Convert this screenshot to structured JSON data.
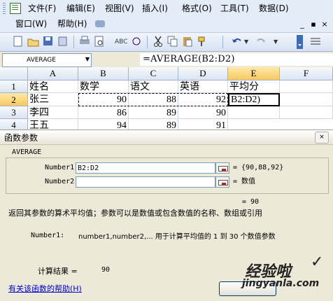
{
  "menubar": {
    "items": [
      "文件(F)",
      "编辑(E)",
      "视图(V)",
      "插入(I)",
      "格式(O)",
      "工具(T)",
      "数据(D)"
    ],
    "row2": [
      "窗口(W)",
      "帮助(H)"
    ],
    "window_controls": [
      "_",
      "▪",
      "×"
    ]
  },
  "formula_bar": {
    "name_box": "AVERAGE",
    "formula": "=AVERAGE(B2:D2)"
  },
  "sheet": {
    "columns": [
      "A",
      "B",
      "C",
      "D",
      "E",
      "F"
    ],
    "rows": [
      "1",
      "2",
      "3",
      "4"
    ],
    "cells": {
      "r1": [
        "姓名",
        "数学",
        "语文",
        "英语",
        "平均分"
      ],
      "r2": [
        "张三",
        "90",
        "88",
        "92",
        "B2:D2)"
      ],
      "r3": [
        "李四",
        "86",
        "89",
        "90"
      ],
      "r4": [
        "王五",
        "94",
        "89",
        "91"
      ]
    }
  },
  "dialog": {
    "title": "函数参数",
    "close": "×",
    "function_name": "AVERAGE",
    "args": [
      {
        "label": "Number1",
        "value": "B2:D2",
        "result": "= {90,88,92}"
      },
      {
        "label": "Number2",
        "value": "",
        "result": "= 数值"
      }
    ],
    "overall_result": "= 90",
    "description": "返回其参数的算术平均值；参数可以是数值或包含数值的名称、数组或引用",
    "arg_help_label": "Number1:",
    "arg_help_text": "number1,number2,... 用于计算平均值的 1 到 30 个数值参数",
    "calc_result_label": "计算结果 =",
    "calc_result_value": "90",
    "help_link": "有关该函数的帮助(H)"
  },
  "watermark": {
    "text": "经验啦",
    "url": "jingyanla.com",
    "check": "✓"
  },
  "colors": {
    "menu_bg": "#e4ecf7",
    "active_header": "#f8c860",
    "link": "#0000cc",
    "dialog_bg": "#ece9d8"
  }
}
